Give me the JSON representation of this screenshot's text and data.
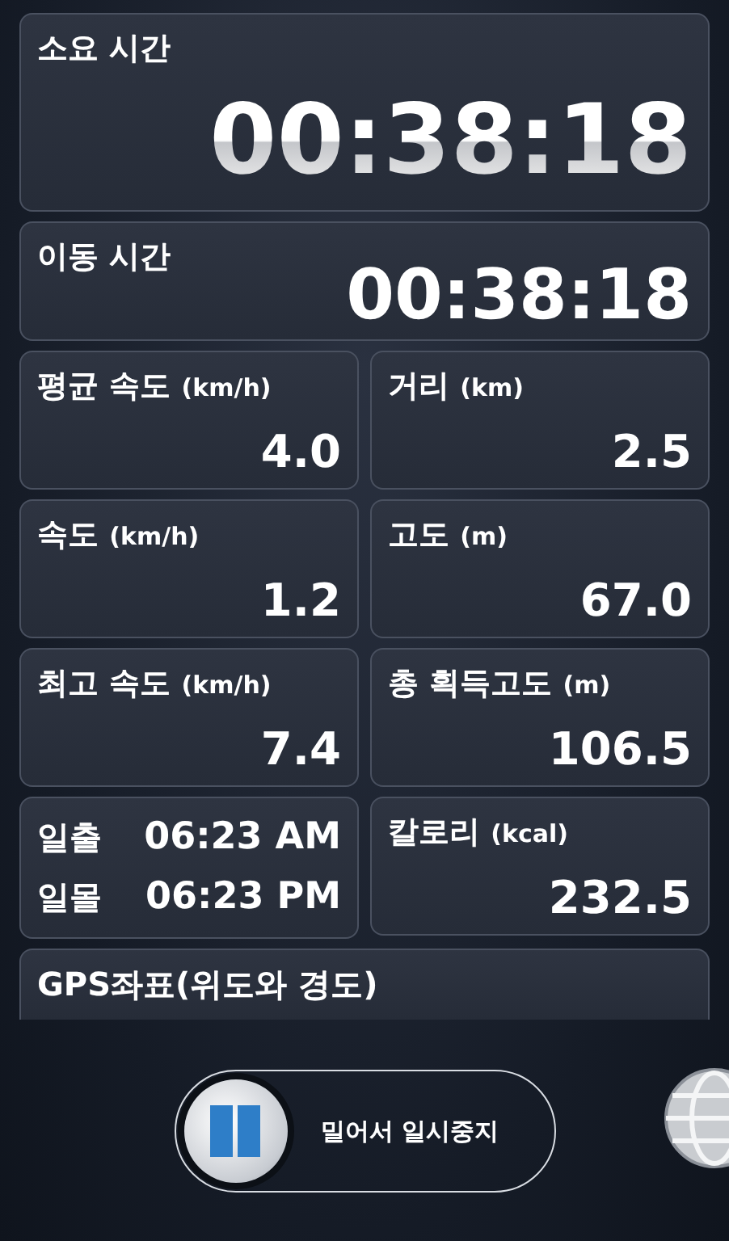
{
  "total_time": {
    "label": "소요 시간",
    "value": "00:38:18"
  },
  "moving_time": {
    "label": "이동 시간",
    "value": "00:38:18"
  },
  "stats": [
    {
      "kind": "stat",
      "label": "평균 속도",
      "unit": "(km/h)",
      "value": "4.0"
    },
    {
      "kind": "stat",
      "label": "거리",
      "unit": "(km)",
      "value": "2.5"
    },
    {
      "kind": "stat",
      "label": "속도",
      "unit": "(km/h)",
      "value": "1.2"
    },
    {
      "kind": "stat",
      "label": "고도",
      "unit": "(m)",
      "value": "67.0"
    },
    {
      "kind": "stat",
      "label": "최고 속도",
      "unit": "(km/h)",
      "value": "7.4"
    },
    {
      "kind": "stat",
      "label": "총 획득고도",
      "unit": "(m)",
      "value": "106.5"
    },
    {
      "kind": "sun",
      "rows": [
        {
          "label": "일출",
          "time": "06:23",
          "period": "AM"
        },
        {
          "label": "일몰",
          "time": "06:23",
          "period": "PM"
        }
      ]
    },
    {
      "kind": "stat",
      "label": "칼로리",
      "unit": "(kcal)",
      "value": "232.5"
    }
  ],
  "gps": {
    "label": "GPS좌표(위도와 경도)"
  },
  "pause_slider": {
    "label": "밀어서 일시중지"
  }
}
